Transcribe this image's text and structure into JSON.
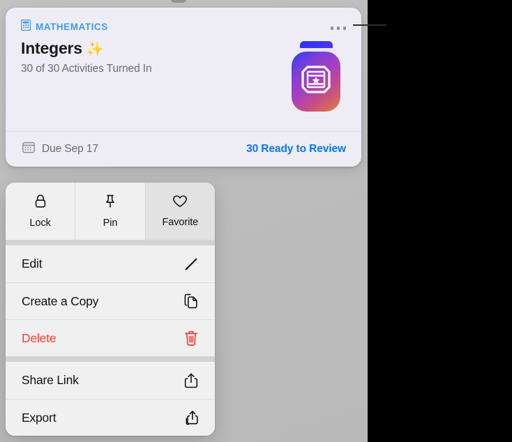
{
  "card": {
    "subject": "MATHEMATICS",
    "subject_icon": "calculator-icon",
    "title": "Integers",
    "title_emoji": "✨",
    "subtitle": "30 of 30 Activities Turned In",
    "more_icon": "ellipsis-icon",
    "app_icon": "keynote-app-icon",
    "due_icon": "calendar-icon",
    "due_text": "Due Sep 17",
    "review_text": "30 Ready to Review",
    "accent_blue": "#0a77f2",
    "subject_blue": "#3e9bea",
    "background": "#eeedf6"
  },
  "menu": {
    "quick_actions": [
      {
        "label": "Lock",
        "icon": "lock-icon",
        "highlighted": false
      },
      {
        "label": "Pin",
        "icon": "pin-icon",
        "highlighted": false
      },
      {
        "label": "Favorite",
        "icon": "heart-icon",
        "highlighted": true
      }
    ],
    "groups": [
      {
        "items": [
          {
            "label": "Edit",
            "icon": "pencil-icon",
            "destructive": false
          },
          {
            "label": "Create a Copy",
            "icon": "duplicate-icon",
            "destructive": false
          },
          {
            "label": "Delete",
            "icon": "trash-icon",
            "destructive": true
          }
        ]
      },
      {
        "items": [
          {
            "label": "Share Link",
            "icon": "share-icon",
            "destructive": false
          },
          {
            "label": "Export",
            "icon": "export-stacked-icon",
            "destructive": false
          }
        ]
      }
    ],
    "danger_color": "#fa3b30",
    "background": "#f1f0f0"
  },
  "annotation": {
    "leader_line": "callout-leader-line"
  }
}
